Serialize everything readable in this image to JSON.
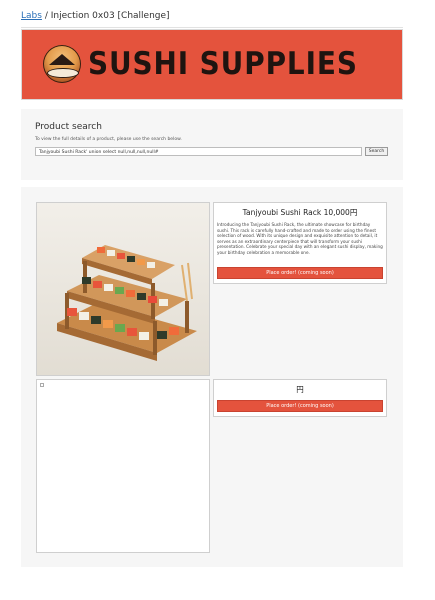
{
  "breadcrumb": {
    "link": "Labs",
    "separator": "/",
    "current": "Injection 0x03 [Challenge]"
  },
  "banner": {
    "brand": "SUSHI SUPPLIES",
    "color": "#e4533d"
  },
  "search": {
    "title": "Product search",
    "help": "To view the full details of a product, please use the search below.",
    "value": "Tanjyoubi Sushi Rack' union select null,null,null,null#",
    "button": "Search"
  },
  "products": [
    {
      "title": "Tanjyoubi Sushi Rack 10,000円",
      "description": "Introducing the Tanjyoubi Sushi Rack, the ultimate showcase for birthday sushi. This rack is carefully hand-crafted and made to order using the finest selection of wood. With its unique design and exquisite attention to detail, it serves as an extraordinary centerpiece that will transform your sushi presentation. Celebrate your special day with an elegant sushi display, making your birthday celebration a memorable one.",
      "button": "Place order! (coming soon)"
    },
    {
      "title": "円",
      "description": "",
      "button": "Place order! (coming soon)"
    }
  ]
}
